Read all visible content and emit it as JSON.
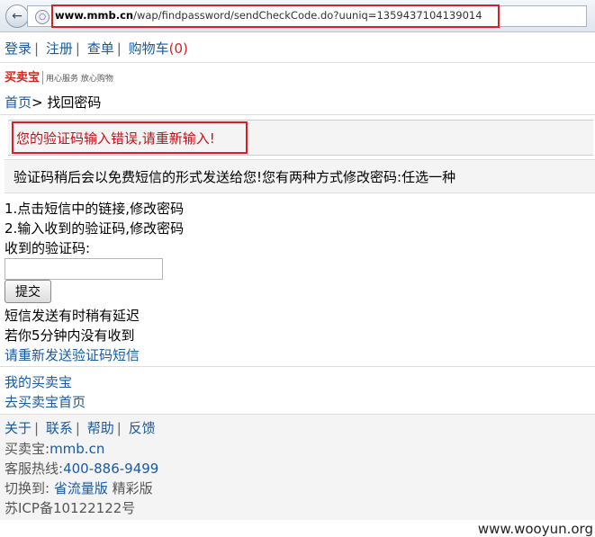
{
  "browser": {
    "url_domain": "www.mmb.cn",
    "url_path": "/wap/findpassword/sendCheckCode.do?uuniq=1359437104139014"
  },
  "topnav": {
    "login": "登录",
    "register": "注册",
    "orders": "查单",
    "cart_label": "购物车",
    "cart_count": "(0)",
    "sep": "|"
  },
  "logo": {
    "name": "买卖宝",
    "tagline": "用心服务 放心购物"
  },
  "breadcrumb": {
    "home": "首页",
    "arrow": ">",
    "current": "找回密码"
  },
  "error_message": "您的验证码输入错误,请重新输入!",
  "info_message": "验证码稍后会以免费短信的形式发送给您!您有两种方式修改密码:任选一种",
  "options": [
    "1.点击短信中的链接,修改密码",
    "2.输入收到的验证码,修改密码"
  ],
  "form": {
    "code_label": "收到的验证码:",
    "code_value": "",
    "submit_label": "提交"
  },
  "sms_notes": [
    "短信发送有时稍有延迟",
    "若你5分钟内没有收到"
  ],
  "resend_link": "请重新发送验证码短信",
  "account_links": [
    "我的买卖宝",
    "去买卖宝首页"
  ],
  "footer": {
    "links": [
      "关于",
      "联系",
      "帮助",
      "反馈"
    ],
    "site_label": "买卖宝:",
    "site_link": "mmb.cn",
    "hotline_label": "客服热线:",
    "hotline": "400-886-9499",
    "switch_label": "切换到:",
    "switch_lite": "省流量版",
    "switch_rich": "精彩版",
    "icp": "苏ICP备10122122号"
  },
  "watermark": "www.wooyun.org",
  "colors": {
    "link": "#1a5aa0",
    "error": "#c3121a",
    "highlight_frame": "#d81f26",
    "panel_bg": "#f4f4f4"
  }
}
